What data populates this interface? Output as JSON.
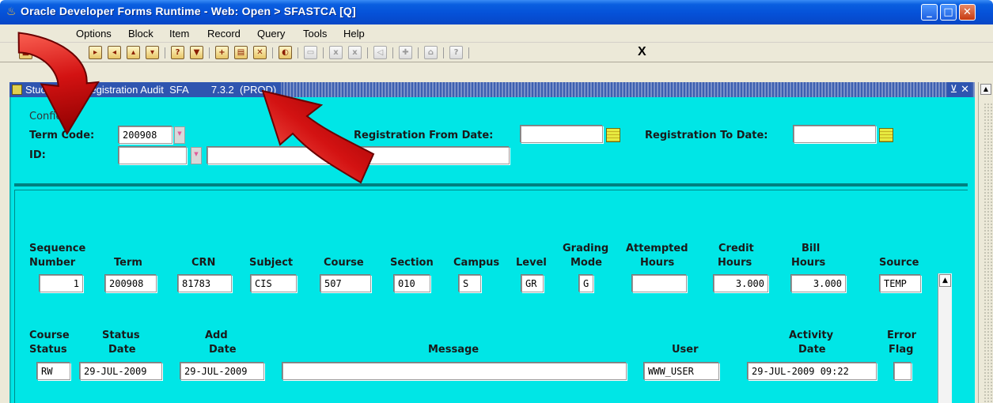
{
  "window": {
    "title": "Oracle Developer Forms Runtime - Web:  Open > SFASTCA [Q]",
    "colors": {
      "titlebar": "#0551d8",
      "form_bg": "#00e6e6",
      "arrow": "#d61a1a"
    }
  },
  "menu": {
    "items": [
      "Options",
      "Block",
      "Item",
      "Record",
      "Query",
      "Tools",
      "Help"
    ]
  },
  "toolbar": {
    "close_label": "X",
    "icons": [
      "save-icon",
      "next-block-icon",
      "prev-block-icon",
      "next-record-icon",
      "prev-record-icon",
      "enter-query-icon",
      "execute-query-icon",
      "insert-record-icon",
      "remove-record-icon",
      "clear-icon",
      "print-icon",
      "help-icon"
    ]
  },
  "form": {
    "title": "Studen    se Registration Audit  SFA        7.3.2  (PROD)",
    "confidential": "Confiden",
    "term_code_label": "Term Code:",
    "term_code_value": "200908",
    "id_label": "ID:",
    "id_value": "",
    "name_value": "",
    "reg_from_label": "Registration From Date:",
    "reg_from_value": "",
    "reg_to_label": "Registration To Date:",
    "reg_to_value": ""
  },
  "row1": {
    "headers": {
      "seq": [
        "Sequence",
        "Number"
      ],
      "term": "Term",
      "crn": "CRN",
      "subject": "Subject",
      "course": "Course",
      "section": "Section",
      "campus": "Campus",
      "level": "Level",
      "grading": [
        "Grading",
        "Mode"
      ],
      "attempted": [
        "Attempted",
        "Hours"
      ],
      "credit": [
        "Credit",
        "Hours"
      ],
      "bill": [
        "Bill",
        "Hours"
      ],
      "source": "Source"
    },
    "values": {
      "seq": "1",
      "term": "200908",
      "crn": "81783",
      "subject": "CIS",
      "course": "507",
      "section": "010",
      "campus": "S",
      "level": "GR",
      "grading": "G",
      "attempted": "",
      "credit": "3.000",
      "bill": "3.000",
      "source": "TEMP"
    }
  },
  "row2": {
    "headers": {
      "course_status": [
        "Course",
        "Status"
      ],
      "status_date": [
        "Status",
        "Date"
      ],
      "add_date": [
        "Add",
        "Date"
      ],
      "message": "Message",
      "user": "User",
      "activity_date": [
        "Activity",
        "Date"
      ],
      "error_flag": [
        "Error",
        "Flag"
      ]
    },
    "values": {
      "course_status": "RW",
      "status_date": "29-JUL-2009",
      "add_date": "29-JUL-2009",
      "message": "",
      "user": "WWW_USER",
      "activity_date": "29-JUL-2009 09:22",
      "error_flag": ""
    }
  }
}
